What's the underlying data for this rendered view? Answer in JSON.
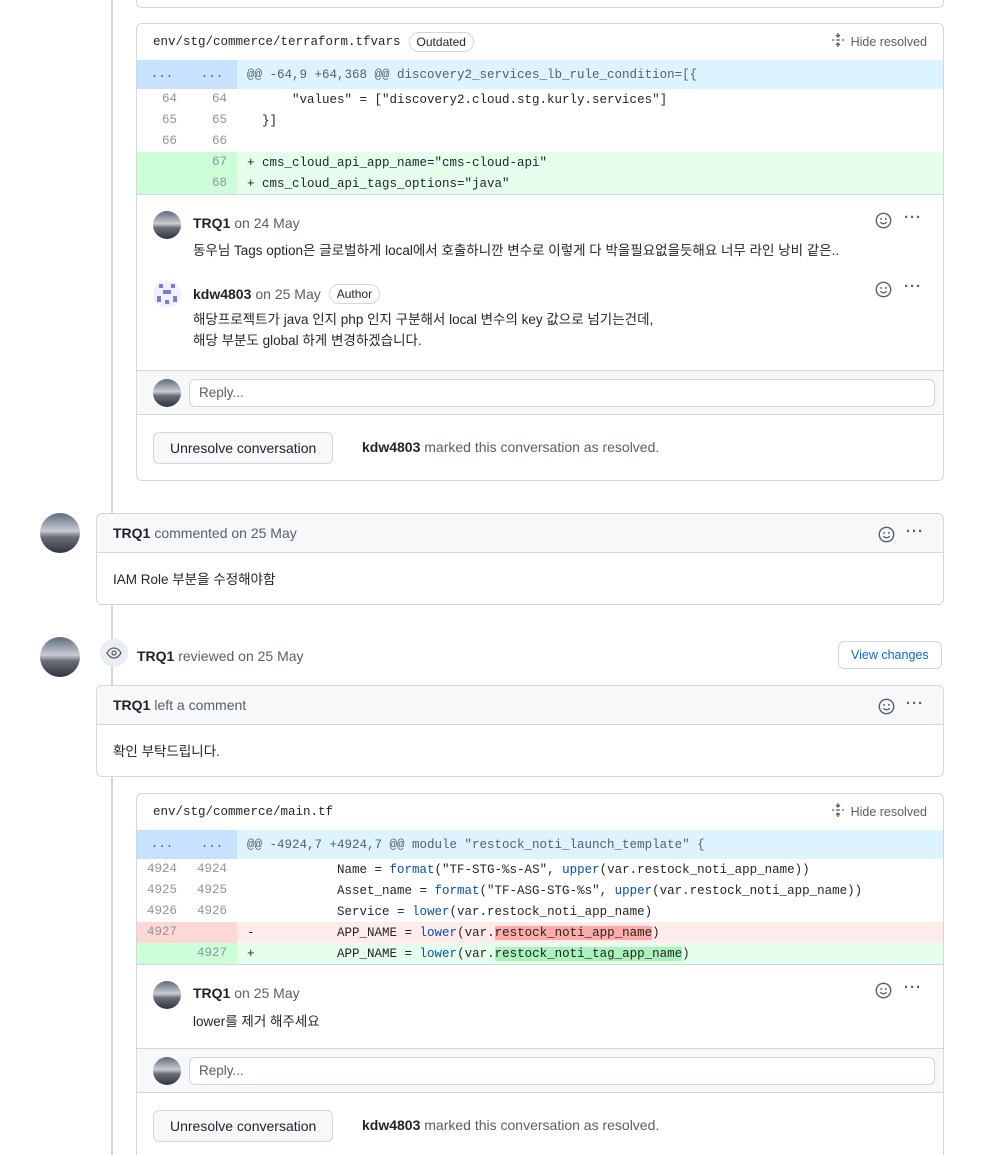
{
  "file1": {
    "path": "env/stg/commerce/terraform.tfvars",
    "outdated_label": "Outdated",
    "hide_resolved": "Hide resolved",
    "hunk_dots": "...",
    "hunk_header": "@@ -64,9 +64,368 @@ discovery2_services_lb_rule_condition=[{",
    "lines": [
      {
        "old": "64",
        "new": "64",
        "code": "      \"values\" = [\"discovery2.cloud.stg.kurly.services\"]"
      },
      {
        "old": "65",
        "new": "65",
        "code": "  }]"
      },
      {
        "old": "66",
        "new": "66",
        "code": ""
      },
      {
        "old": "",
        "new": "67",
        "code": "+ cms_cloud_api_app_name=\"cms-cloud-api\""
      },
      {
        "old": "",
        "new": "68",
        "code": "+ cms_cloud_api_tags_options=\"java\""
      }
    ],
    "comments": [
      {
        "author": "TRQ1",
        "date": "on 24 May",
        "body": "동우님 Tags option은 글로벌하게 local에서 호출하니깐 변수로 이렇게 다 박을필요없을듯해요 너무 라인 낭비 같은.."
      },
      {
        "author": "kdw4803",
        "date": "on 25 May",
        "badge": "Author",
        "body1": "해당프로젝트가 java 인지 php 인지 구분해서 local 변수의 key 값으로 넘기는건데,",
        "body2": "해당 부분도 global 하게 변경하겠습니다."
      }
    ],
    "reply_placeholder": "Reply...",
    "unresolve_label": "Unresolve conversation",
    "resolved_by": "kdw4803",
    "resolved_text": "marked this conversation as resolved."
  },
  "comment1": {
    "author": "TRQ1",
    "action": "commented on 25 May",
    "body": "IAM Role 부분을 수정해야함"
  },
  "review": {
    "author": "TRQ1",
    "action": "reviewed on 25 May",
    "view_changes": "View changes",
    "card_author": "TRQ1",
    "card_action": "left a comment",
    "body": "확인 부탁드립니다."
  },
  "file2": {
    "path": "env/stg/commerce/main.tf",
    "hide_resolved": "Hide resolved",
    "hunk_dots": "...",
    "hunk_header": "@@ -4924,7 +4924,7 @@ module \"restock_noti_launch_template\" {",
    "lines": [
      {
        "old": "4924",
        "new": "4924",
        "pre": "            Name = ",
        "fn": "format",
        "rest": "(\"TF-STG-%s-AS\", ",
        "fn2": "upper",
        "rest2": "(var.restock_noti_app_name))"
      },
      {
        "old": "4925",
        "new": "4925",
        "pre": "            Asset_name = ",
        "fn": "format",
        "rest": "(\"TF-ASG-STG-%s\", ",
        "fn2": "upper",
        "rest2": "(var.restock_noti_app_name))"
      },
      {
        "old": "4926",
        "new": "4926",
        "pre": "            Service = ",
        "fn": "lower",
        "rest": "(var.restock_noti_app_name)",
        "fn2": "",
        "rest2": ""
      }
    ],
    "del_line": {
      "old": "4927",
      "sign": "-",
      "pre": "           APP_NAME = ",
      "fn": "lower",
      "mid": "(var.",
      "hl": "restock_noti_app_name",
      "end": ")"
    },
    "add_line": {
      "new": "4927",
      "sign": "+",
      "pre": "           APP_NAME = ",
      "fn": "lower",
      "mid": "(var.",
      "hl": "restock_noti_tag_app_name",
      "end": ")"
    },
    "comment": {
      "author": "TRQ1",
      "date": "on 25 May",
      "body": "lower를 제거 해주세요"
    },
    "reply_placeholder": "Reply...",
    "unresolve_label": "Unresolve conversation",
    "resolved_by": "kdw4803",
    "resolved_text": "marked this conversation as resolved."
  }
}
